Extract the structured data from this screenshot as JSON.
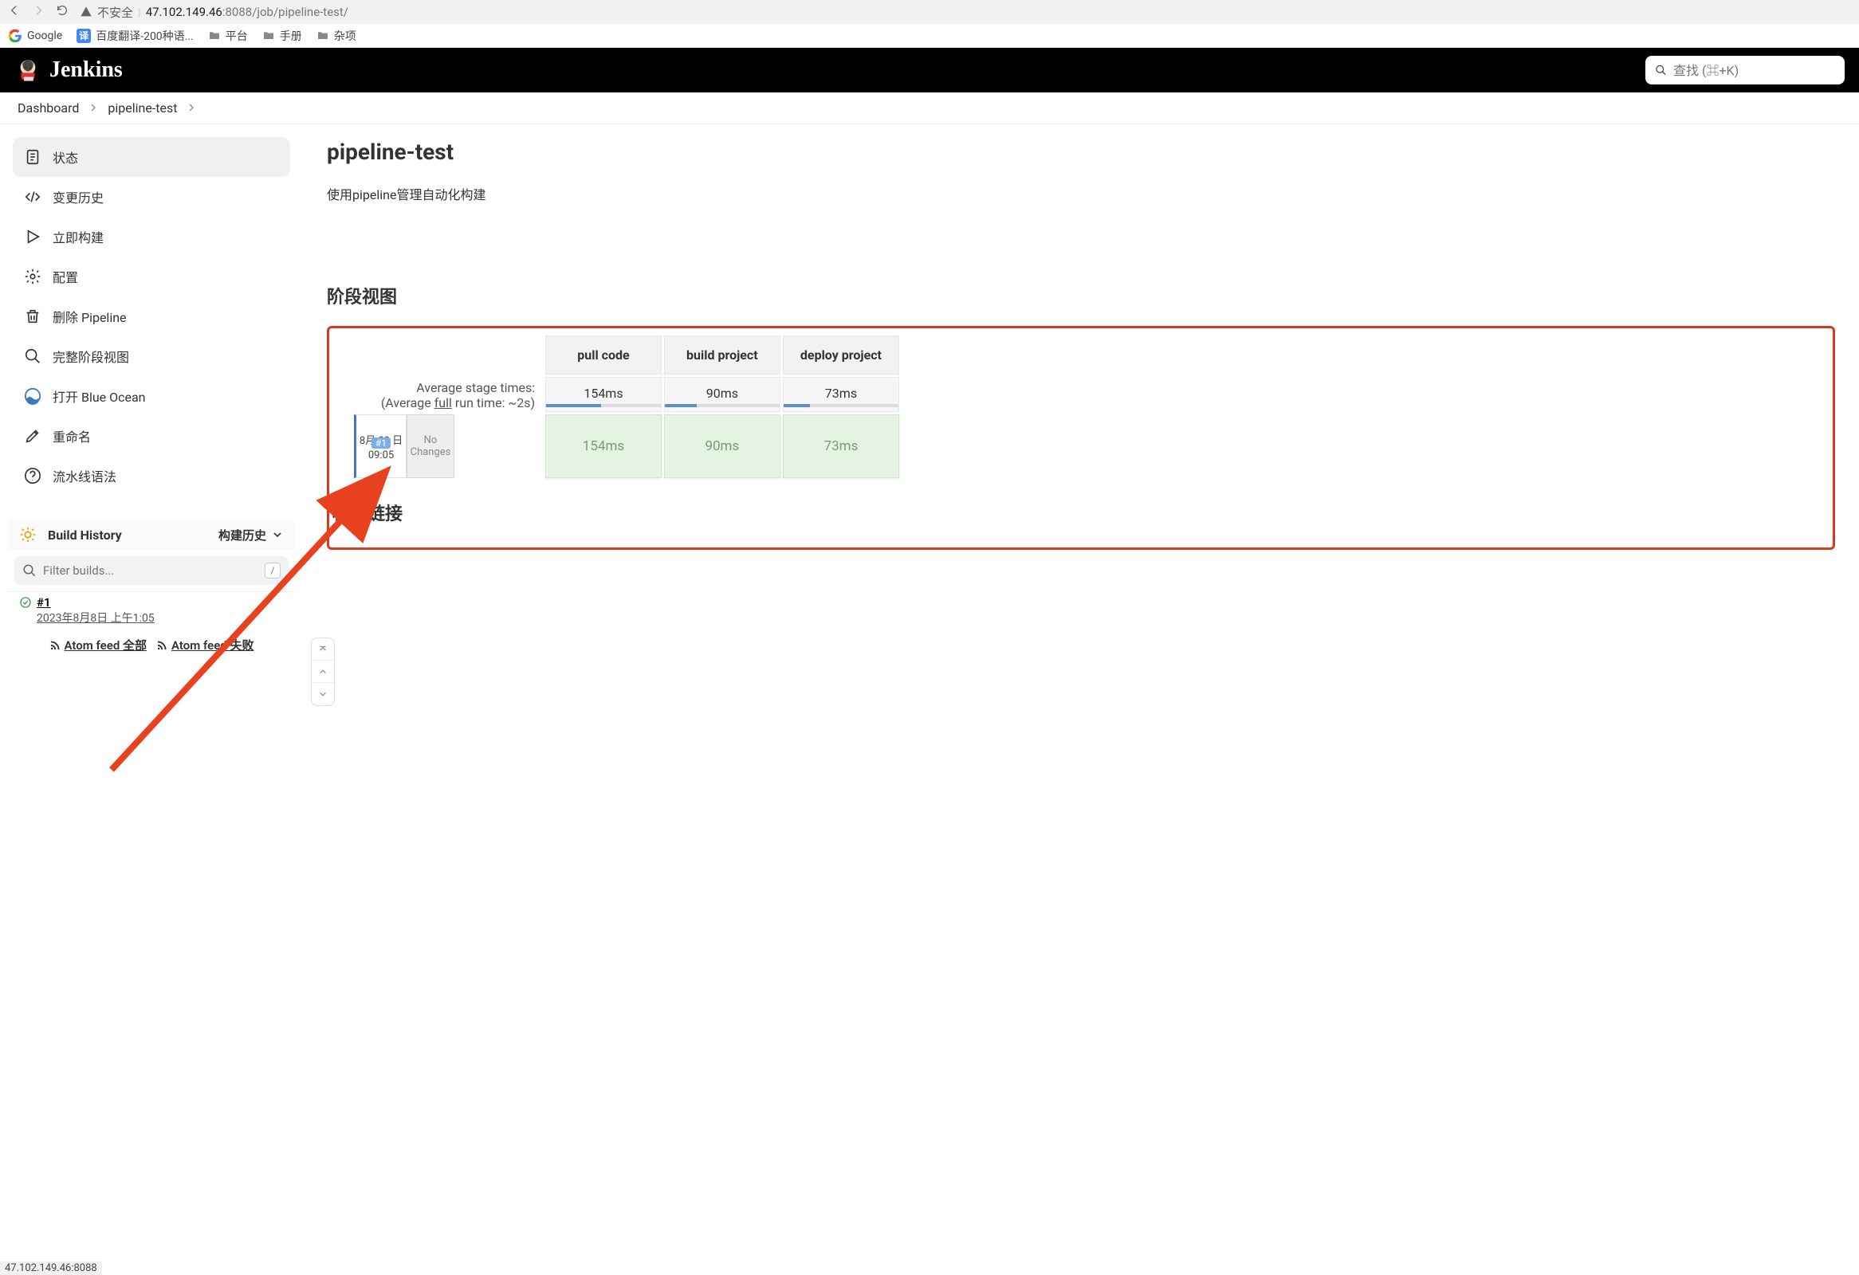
{
  "browser": {
    "not_safe": "不安全",
    "url_host": "47.102.149.46",
    "url_port": ":8088",
    "url_path": "/job/pipeline-test/"
  },
  "bookmarks": {
    "google": "Google",
    "baidu": "百度翻译-200种语...",
    "platform": "平台",
    "manual": "手册",
    "misc": "杂项"
  },
  "header": {
    "title": "Jenkins",
    "search_placeholder": "查找 (⌘+K)"
  },
  "breadcrumbs": {
    "dashboard": "Dashboard",
    "job": "pipeline-test"
  },
  "sidebar": {
    "status": "状态",
    "changes": "变更历史",
    "build_now": "立即构建",
    "configure": "配置",
    "delete": "删除 Pipeline",
    "full_stage": "完整阶段视图",
    "blue_ocean": "打开 Blue Ocean",
    "rename": "重命名",
    "syntax": "流水线语法"
  },
  "build_history": {
    "title": "Build History",
    "trend": "构建历史",
    "filter_placeholder": "Filter builds...",
    "filter_kbd": "/",
    "entries": {
      "id": "#1",
      "date": "2023年8月8日 上午1:05"
    },
    "atom_all": "Atom feed 全部",
    "atom_fail": "Atom feed 失败"
  },
  "main": {
    "title": "pipeline-test",
    "desc": "使用pipeline管理自动化构建",
    "stage_title": "阶段视图",
    "links_title": "相关链接"
  },
  "stage": {
    "columns": {
      "c0": "pull code",
      "c1": "build project",
      "c2": "deploy project"
    },
    "avg_label": "Average stage times:",
    "avg_sub_pre": "(Average ",
    "avg_sub_full": "full",
    "avg_sub_post": " run time: ~2s)",
    "avg_times": {
      "c0": "154ms",
      "c1": "90ms",
      "c2": "73ms"
    },
    "run": {
      "badge": "#1",
      "date_line1": "8月 08 日",
      "date_line2": "09:05",
      "changes": "No Changes",
      "times": {
        "c0": "154ms",
        "c1": "90ms",
        "c2": "73ms"
      }
    }
  },
  "status_bar": "47.102.149.46:8088"
}
